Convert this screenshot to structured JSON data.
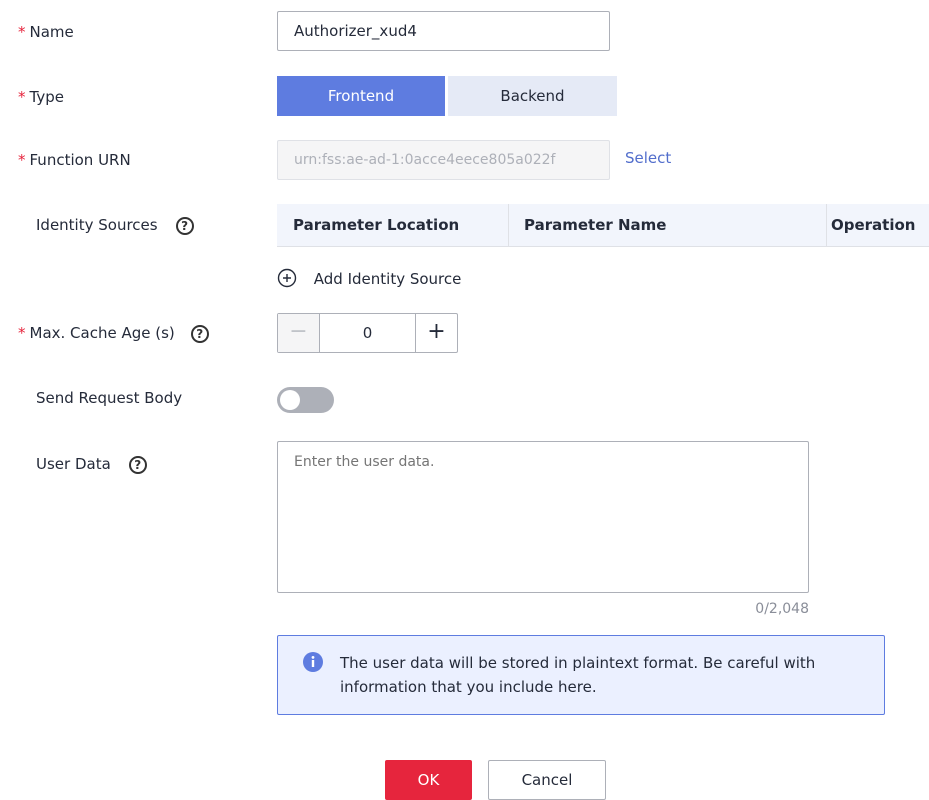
{
  "form": {
    "name": {
      "label": "Name",
      "required": true,
      "value": "Authorizer_xud4"
    },
    "type": {
      "label": "Type",
      "required": true,
      "options": [
        "Frontend",
        "Backend"
      ],
      "selected": "Frontend"
    },
    "function_urn": {
      "label": "Function URN",
      "required": true,
      "value": "urn:fss:ae-ad-1:0acce4eece805a022f",
      "select_label": "Select"
    },
    "identity_sources": {
      "label": "Identity Sources",
      "columns": [
        "Parameter Location",
        "Parameter Name",
        "Operation"
      ],
      "add_label": "Add Identity Source"
    },
    "max_cache_age": {
      "label": "Max. Cache Age (s)",
      "required": true,
      "value": "0",
      "decrement": "−",
      "increment": "+"
    },
    "send_request_body": {
      "label": "Send Request Body",
      "enabled": false
    },
    "user_data": {
      "label": "User Data",
      "placeholder": "Enter the user data.",
      "counter": "0/2,048"
    },
    "notice": "The user data will be stored in plaintext format. Be careful with information that you include here."
  },
  "actions": {
    "ok": "OK",
    "cancel": "Cancel"
  },
  "colors": {
    "primary": "#5e7ce0",
    "danger": "#e6253d",
    "link": "#526ecc",
    "info_bg": "#ebf0ff"
  },
  "icons": {
    "help": "question-circle-icon",
    "add": "plus-circle-icon",
    "info": "info-icon"
  }
}
